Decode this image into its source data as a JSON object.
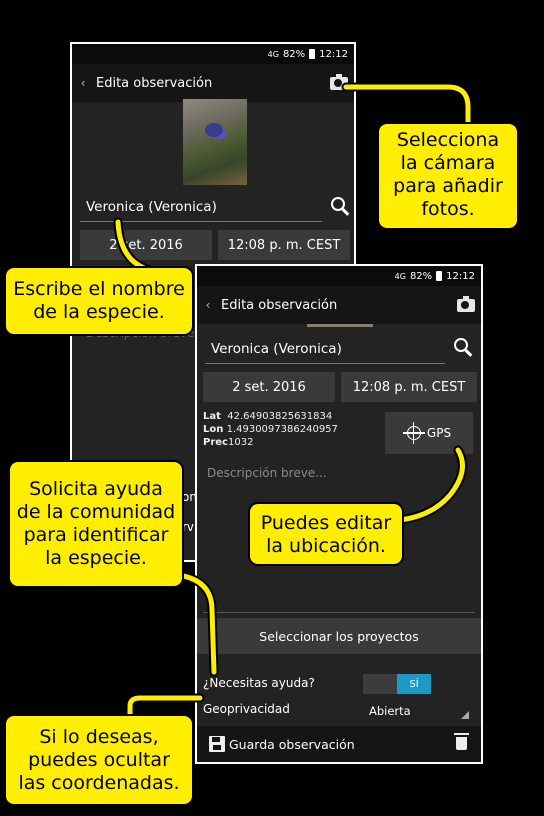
{
  "status": {
    "network": "4G",
    "battery": "82%",
    "time": "12:12"
  },
  "appbar": {
    "back": "‹",
    "title": "Edita observación",
    "camera_icon": "camera-icon"
  },
  "observation": {
    "species": "Veronica (Veronica)",
    "date": "2 set. 2016",
    "time": "12:08 p. m. CEST",
    "lat_label": "Lat",
    "lat": "42.64903825631834",
    "lon_label": "Lon",
    "lon": "1.4930097386240957",
    "prec_label": "Prec",
    "prec": "1032",
    "description_placeholder": "Descripción breve..."
  },
  "phone1": {
    "date_partial": "2 set. 2016",
    "overlap_texts": [
      "on",
      "rv"
    ]
  },
  "buttons": {
    "gps": "GPS",
    "projects": "Seleccionar los proyectos",
    "save": "Guarda observación"
  },
  "help": {
    "label": "¿Necesitas ayuda?",
    "toggle_on": "SÍ"
  },
  "geoprivacy": {
    "label": "Geoprivacidad",
    "value": "Abierta"
  },
  "callouts": {
    "camera": [
      "Selecciona",
      "la cámara",
      "para añadir",
      "fotos."
    ],
    "species": [
      "Escribe el nombre",
      "de la especie."
    ],
    "location": [
      "Puedes editar",
      "la ubicación."
    ],
    "community": [
      "Solicita ayuda",
      "de la comunidad",
      "para identificar",
      "la especie."
    ],
    "privacy": [
      "Si lo deseas,",
      "puedes ocultar",
      "las coordenadas."
    ]
  },
  "colors": {
    "callout_bg": "#ffee00",
    "accent": "#1a9ac4",
    "app_bg": "#232323"
  }
}
